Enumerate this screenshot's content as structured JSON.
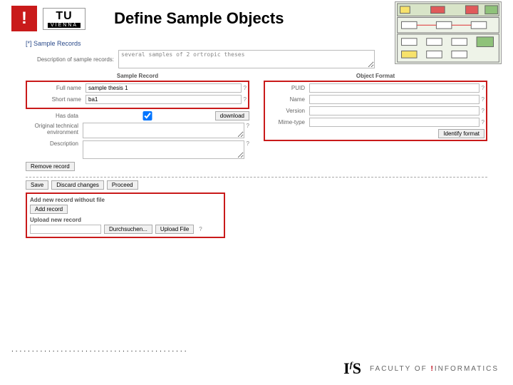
{
  "header": {
    "excl": "!",
    "tu": "TU",
    "vienna": "VIENNA",
    "title": "Define Sample Objects"
  },
  "form": {
    "section": "[*] Sample Records",
    "desc_label": "Description of sample records:",
    "desc_value": "several samples of 2 ortropic theses",
    "sample_header": "Sample Record",
    "format_header": "Object Format",
    "fullname_label": "Full name",
    "fullname_value": "sample thesis 1",
    "shortname_label": "Short name",
    "shortname_value": "ba1",
    "hasdata_label": "Has data",
    "download": "download",
    "origenv_label": "Original technical environment",
    "description_label": "Description",
    "puid_label": "PUID",
    "name_label": "Name",
    "version_label": "Version",
    "mime_label": "Mime-type",
    "identify_btn": "Identify format",
    "remove_btn": "Remove record",
    "save_btn": "Save",
    "discard_btn": "Discard changes",
    "proceed_btn": "Proceed",
    "addnew_title": "Add new record without file",
    "addrecord_btn": "Add record",
    "upload_title": "Upload new record",
    "browse_btn": "Durchsuchen...",
    "uploadfile_btn": "Upload File",
    "q": "?"
  },
  "footer": {
    "ifs": "I f S",
    "faculty": "FACULTY OF ",
    "exclam": "!",
    "informatics": "INFORMATICS",
    "dots": "..........................................."
  }
}
